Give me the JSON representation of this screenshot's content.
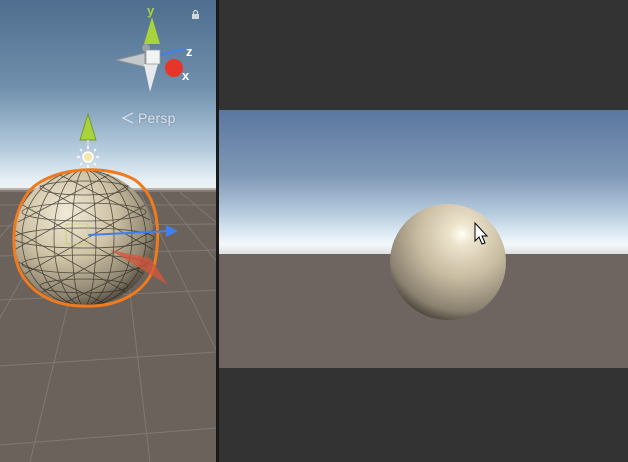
{
  "scene_view": {
    "projection_label": "Persp",
    "gizmo_axes": {
      "y": "y",
      "z": "z",
      "x": "x"
    }
  },
  "colors": {
    "selection_outline": "#f07a1e",
    "axis_x": "#e8352a",
    "axis_y": "#a6d43a",
    "axis_z": "#3f7ff0",
    "editor_background": "#333333"
  },
  "icons": [
    "lock-icon",
    "view-gizmo",
    "directional-light-icon",
    "mouse-cursor-icon"
  ]
}
